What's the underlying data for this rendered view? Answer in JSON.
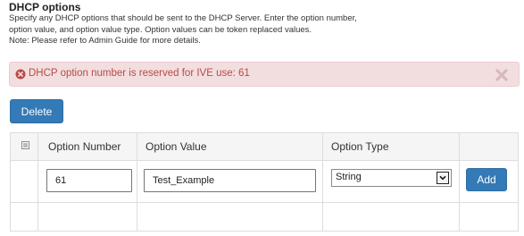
{
  "section": {
    "title": "DHCP options",
    "description": [
      "Specify any DHCP options that should be sent to the DHCP Server. Enter the option number,",
      "option value, and option value type. Option values can be token replaced values.",
      "Note: Please refer to Admin Guide for more details."
    ]
  },
  "alert": {
    "message": "DHCP option number is reserved for IVE use: 61",
    "icon": "error-circle-x-icon",
    "close_icon": "close-x-icon",
    "color": "#b94a48",
    "background": "#f2dede"
  },
  "toolbar": {
    "delete_label": "Delete"
  },
  "table": {
    "columns": [
      "Option Number",
      "Option Value",
      "Option Type"
    ],
    "select_all_icon": "select-all-checkbox-icon",
    "entry_row": {
      "option_number": "61",
      "option_value": "Test_Example",
      "option_type": "String",
      "add_label": "Add"
    }
  },
  "colors": {
    "primary_button": "#337ab7",
    "header_background": "#f5f5f5",
    "grid_border": "#dddddd"
  }
}
